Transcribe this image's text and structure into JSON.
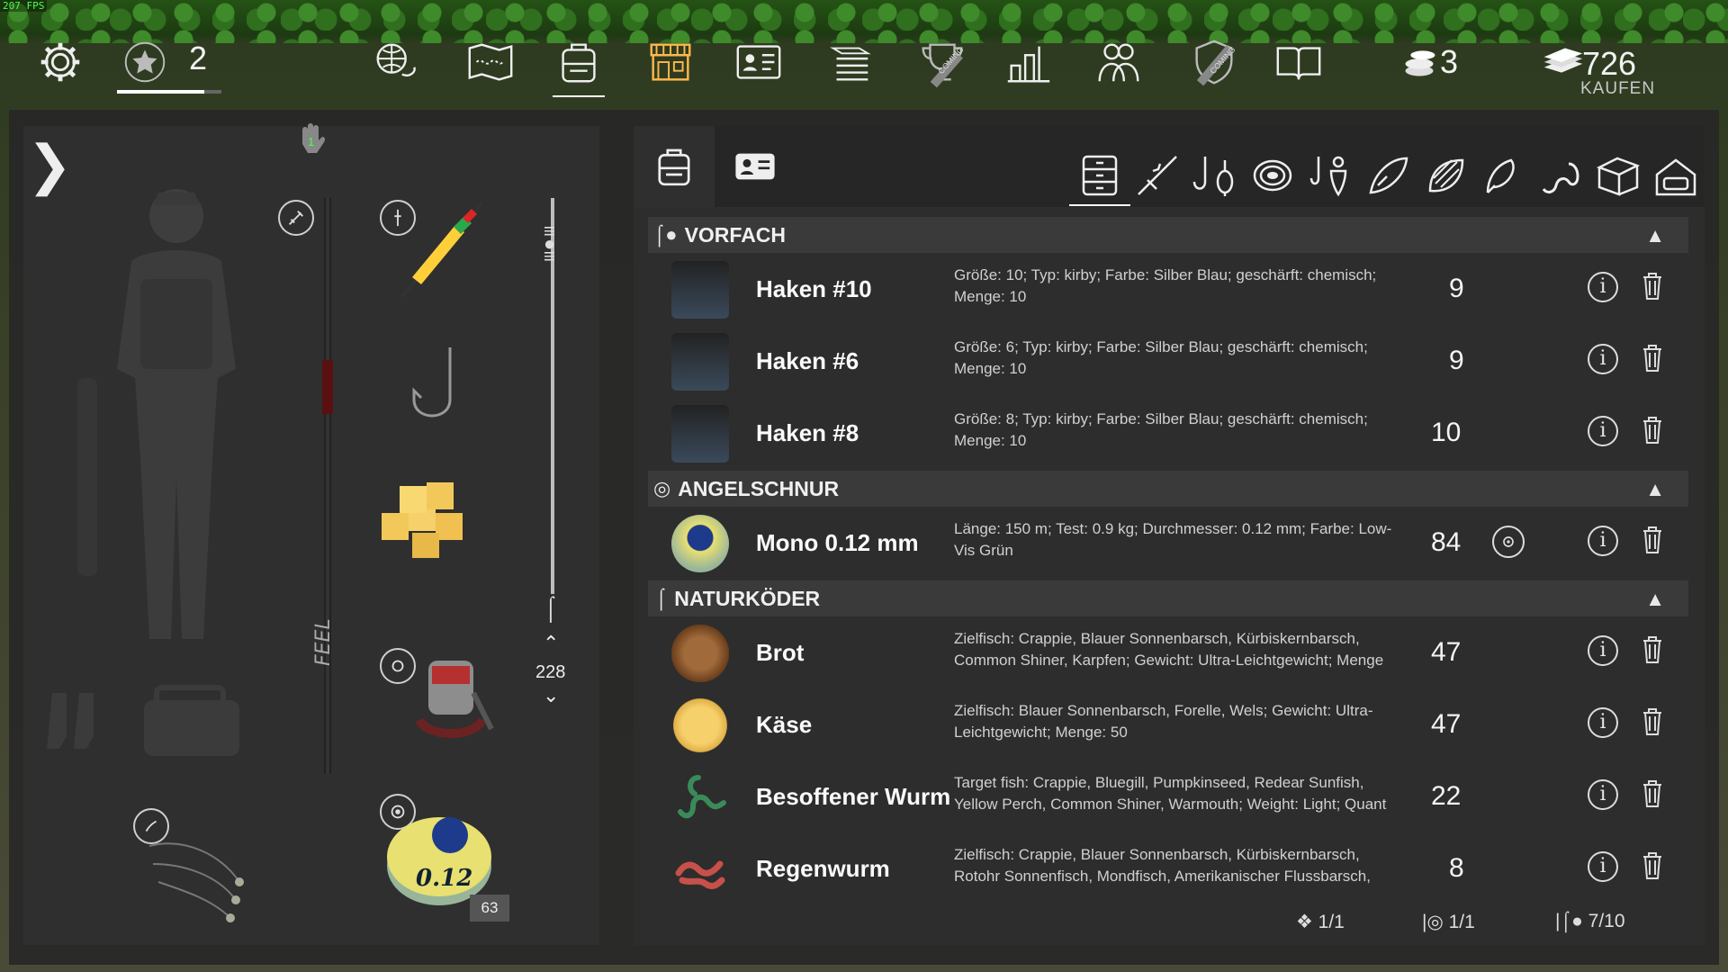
{
  "fps": "207 FPS",
  "top": {
    "rank_level": "2",
    "coins": "3",
    "money": "726",
    "buy_label": "KAUFEN",
    "coming_badge": "COMING"
  },
  "left": {
    "handle_badge": "1",
    "line_length": "228",
    "spool_count": "63"
  },
  "sections": [
    {
      "title": "VORFACH",
      "items": [
        {
          "name": "Haken #10",
          "desc": "Größe: 10; Typ: kirby; Farbe: Silber Blau; geschärft: chemisch; Menge: 10",
          "qty": "9"
        },
        {
          "name": "Haken #6",
          "desc": "Größe: 6; Typ: kirby; Farbe: Silber Blau; geschärft: chemisch; Menge: 10",
          "qty": "9"
        },
        {
          "name": "Haken #8",
          "desc": "Größe: 8; Typ: kirby; Farbe: Silber Blau; geschärft: chemisch; Menge: 10",
          "qty": "10"
        }
      ]
    },
    {
      "title": "ANGELSCHNUR",
      "items": [
        {
          "name": "Mono 0.12 mm",
          "desc": "Länge: 150 m; Test: 0.9 kg; Durchmesser: 0.12 mm; Farbe: Low-Vis Grün",
          "qty": "84"
        }
      ]
    },
    {
      "title": "NATURKÖDER",
      "items": [
        {
          "name": "Brot",
          "desc": "Zielfisch: Crappie, Blauer Sonnenbarsch, Kürbiskernbarsch, Common Shiner, Karpfen; Gewicht: Ultra-Leichtgewicht; Menge",
          "qty": "47"
        },
        {
          "name": "Käse",
          "desc": "Zielfisch: Blauer Sonnenbarsch, Forelle, Wels; Gewicht: Ultra-Leichtgewicht; Menge: 50",
          "qty": "47"
        },
        {
          "name": "Besoffener Wurm",
          "desc": "Target fish: Crappie, Bluegill, Pumpkinseed, Redear Sunfish, Yellow Perch, Common Shiner, Warmouth; Weight: Light; Quant",
          "qty": "22"
        },
        {
          "name": "Regenwurm",
          "desc": "Zielfisch: Crappie, Blauer Sonnenbarsch, Kürbiskernbarsch, Rotohr Sonnenfisch, Mondfisch, Amerikanischer Flussbarsch,",
          "qty": "8"
        }
      ]
    }
  ],
  "footer": {
    "rods": "1/1",
    "lines": "1/1",
    "leaders": "7/10"
  },
  "colors": {
    "accent": "#ffb84a",
    "panel": "#2d2d2d",
    "section": "#3a3a3a"
  }
}
